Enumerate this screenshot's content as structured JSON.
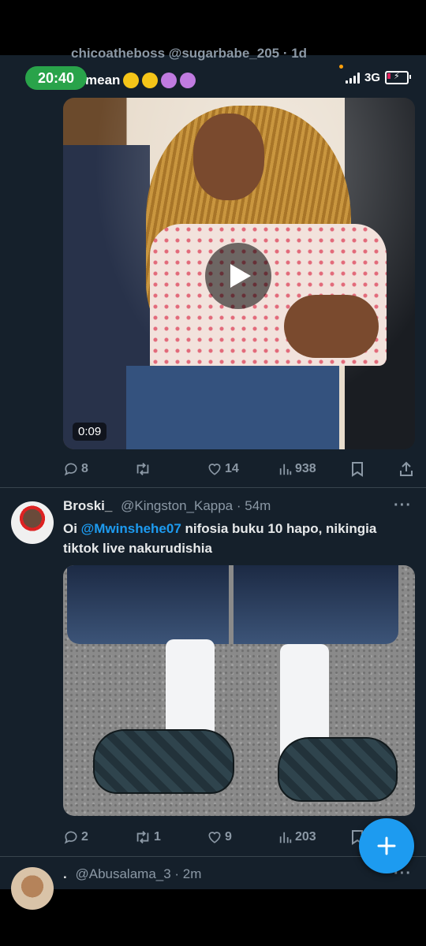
{
  "status_bar": {
    "time": "20:40",
    "network": "3G"
  },
  "prev_tweet": {
    "header_partial": "chicoatheboss @sugarbabe_205 · 1d",
    "text_fragment": "mean"
  },
  "tweet1": {
    "video_duration": "0:09",
    "replies": "8",
    "retweets": "",
    "likes": "14",
    "views": "938"
  },
  "tweet2": {
    "name": "Broski_",
    "handle_time": "@Kingston_Kappa · 54m",
    "text_pre": "Oi ",
    "mention": "@Mwinshehe07",
    "text_post": " nifosia buku 10 hapo, nikingia tiktok live nakurudishia",
    "replies": "2",
    "retweets": "1",
    "likes": "9",
    "views": "203"
  },
  "tweet3": {
    "name": ".",
    "handle_time": "@Abusalama_3 · 2m"
  },
  "more_label": "···",
  "colors": {
    "accent": "#1d9bf0",
    "background": "#15202b",
    "muted": "#8b98a5"
  },
  "icons": [
    "reply-icon",
    "retweet-icon",
    "like-icon",
    "views-icon",
    "bookmark-icon",
    "share-icon",
    "compose-icon",
    "play-icon"
  ]
}
